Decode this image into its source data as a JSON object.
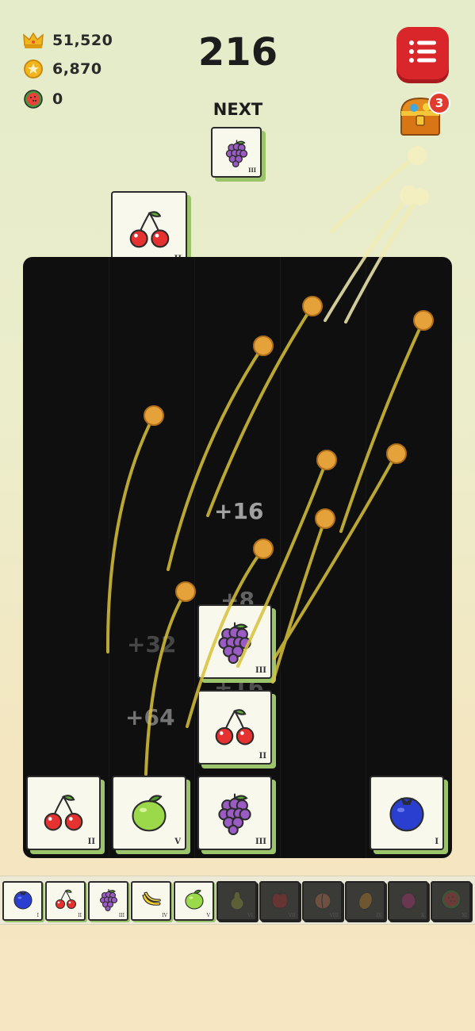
{
  "stats": {
    "crowns": "51,520",
    "coins": "6,870",
    "watermelons": "0"
  },
  "score": "216",
  "next": {
    "label": "NEXT",
    "fruit": "grape",
    "rank": "III"
  },
  "chest": {
    "badge": "3"
  },
  "held_tile": {
    "fruit": "cherry",
    "rank": "II"
  },
  "board": {
    "tiles": [
      {
        "fruit": "grape",
        "rank": "III"
      },
      {
        "fruit": "cherry",
        "rank": "II"
      },
      {
        "fruit": "cherry",
        "rank": "II"
      },
      {
        "fruit": "lime",
        "rank": "V"
      },
      {
        "fruit": "grape",
        "rank": "III"
      },
      {
        "fruit": "blueberry",
        "rank": "I"
      }
    ],
    "floating_scores": [
      "+16",
      "+8",
      "+32",
      "+16",
      "+64"
    ]
  },
  "collection": [
    {
      "fruit": "blueberry",
      "rank": "I",
      "locked": false
    },
    {
      "fruit": "cherry",
      "rank": "II",
      "locked": false
    },
    {
      "fruit": "grape",
      "rank": "III",
      "locked": false
    },
    {
      "fruit": "banana",
      "rank": "IV",
      "locked": false
    },
    {
      "fruit": "lime",
      "rank": "V",
      "locked": false
    },
    {
      "fruit": "pear",
      "rank": "VI",
      "locked": true
    },
    {
      "fruit": "apple",
      "rank": "VII",
      "locked": true
    },
    {
      "fruit": "peach",
      "rank": "VIII",
      "locked": true
    },
    {
      "fruit": "mango",
      "rank": "IX",
      "locked": true
    },
    {
      "fruit": "dragonfruit",
      "rank": "X",
      "locked": true
    },
    {
      "fruit": "watermelon",
      "rank": "XI",
      "locked": true
    }
  ],
  "colors": {
    "tile_shadow": "#9cc46a",
    "menu_button": "#d8262b",
    "board": "#0f0f10",
    "trail": "#d9c23a",
    "coin": "#e6a23a"
  }
}
